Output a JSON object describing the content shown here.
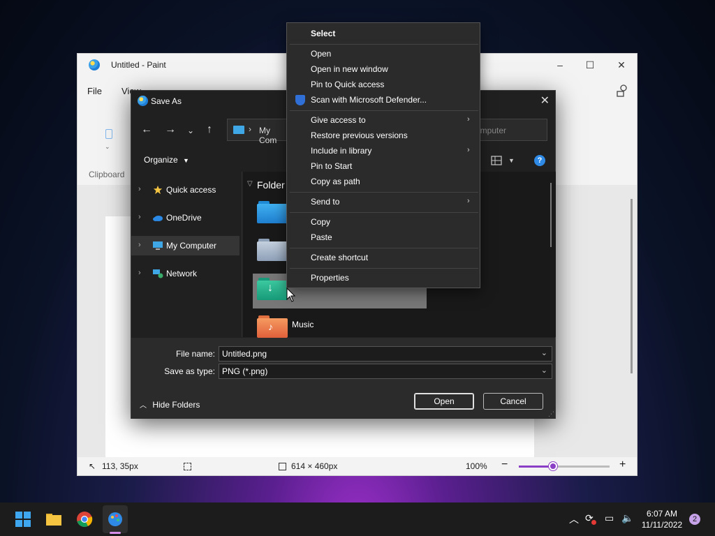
{
  "paint": {
    "title": "Untitled - Paint",
    "menu": {
      "file": "File",
      "view": "View"
    },
    "ribbon_label": "Clipboard",
    "status": {
      "cursor_pos": "113, 35px",
      "canvas_size": "614 × 460px",
      "zoom": "100%"
    },
    "zoom_value": 0.38
  },
  "dialog": {
    "title": "Save As",
    "address": "My Com",
    "search_placeholder": "omputer",
    "organize_label": "Organize",
    "nav": [
      {
        "label": "Quick access",
        "icon": "star-icon"
      },
      {
        "label": "OneDrive",
        "icon": "cloud-icon"
      },
      {
        "label": "My Computer",
        "icon": "computer-icon"
      },
      {
        "label": "Network",
        "icon": "network-icon"
      }
    ],
    "group_header": "Folder",
    "music_label": "Music",
    "file_name_label": "File name:",
    "file_name_value": "Untitled.png",
    "save_type_label": "Save as type:",
    "save_type_value": "PNG (*.png)",
    "hide_folders_label": "Hide Folders",
    "open_button": "Open",
    "cancel_button": "Cancel"
  },
  "context_menu": {
    "items": [
      {
        "label": "Select",
        "bold": true
      },
      {
        "label": "Open"
      },
      {
        "label": "Open in new window"
      },
      {
        "label": "Pin to Quick access"
      },
      {
        "label": "Scan with Microsoft Defender...",
        "icon": "defender-shield-icon"
      },
      {
        "label": "Give access to",
        "submenu": true
      },
      {
        "label": "Restore previous versions"
      },
      {
        "label": "Include in library",
        "submenu": true
      },
      {
        "label": "Pin to Start"
      },
      {
        "label": "Copy as path"
      },
      {
        "label": "Send to",
        "submenu": true
      },
      {
        "label": "Copy"
      },
      {
        "label": "Paste"
      },
      {
        "label": "Create shortcut"
      },
      {
        "label": "Properties"
      }
    ]
  },
  "taskbar": {
    "time": "6:07 AM",
    "date": "11/11/2022",
    "notification_count": "2"
  },
  "colors": {
    "accent": "#8a3fc6",
    "dialog_bg": "#202020",
    "menu_bg": "#2b2b2b"
  }
}
